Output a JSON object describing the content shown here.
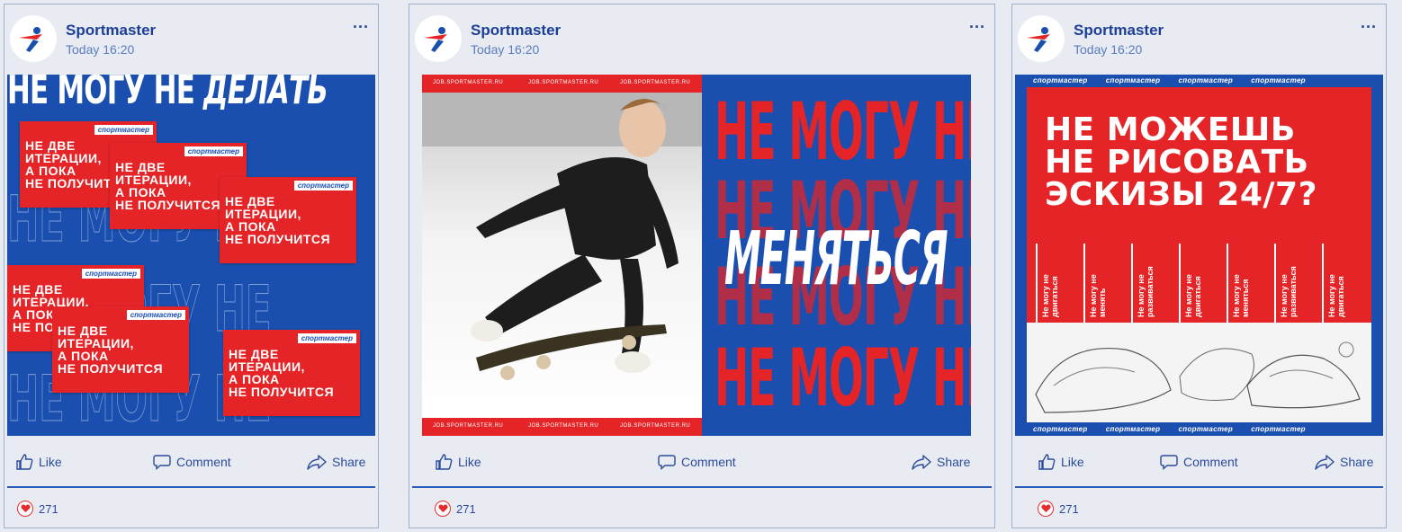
{
  "posts": [
    {
      "author": "Sportmaster",
      "time": "Today 16:20",
      "more": "...",
      "image": {
        "headline_prefix": "НЕ МОГУ НЕ ",
        "headline_italic": "ДЕЛАТЬ",
        "card_brand": "спортмастер",
        "card_text_line1": "НЕ ДВЕ",
        "card_text_line2": "ИТЕРАЦИИ,",
        "card_text_line3": "А ПОКА",
        "card_text_line4": "НЕ ПОЛУЧИТСЯ"
      },
      "actions": {
        "like": "Like",
        "comment": "Comment",
        "share": "Share"
      },
      "likes": "271"
    },
    {
      "author": "Sportmaster",
      "time": "Today 16:20",
      "more": "...",
      "image": {
        "url_strip": "JOB.SPORTMASTER.RU",
        "repeat_line": "НЕ МОГУ НЕ",
        "overlay": "МЕНЯТЬСЯ"
      },
      "actions": {
        "like": "Like",
        "comment": "Comment",
        "share": "Share"
      },
      "likes": "271"
    },
    {
      "author": "Sportmaster",
      "time": "Today 16:20",
      "more": "...",
      "image": {
        "brand": "спортмастер",
        "headline_1": "НЕ МОЖЕШЬ",
        "headline_2": "НЕ РИСОВАТЬ",
        "headline_3": "ЭСКИЗЫ 24/7?",
        "columns": [
          "Не могу не двигаться",
          "Не могу не менять",
          "Не могу не развиваться",
          "Не могу не двигаться",
          "Не могу не меняться",
          "Не могу не развиваться",
          "Не могу не двигаться"
        ]
      },
      "actions": {
        "like": "Like",
        "comment": "Comment",
        "share": "Share"
      },
      "likes": "271"
    }
  ],
  "colors": {
    "brand_blue": "#1a4fb0",
    "brand_red": "#e42426",
    "text_blue": "#1c3f95"
  }
}
